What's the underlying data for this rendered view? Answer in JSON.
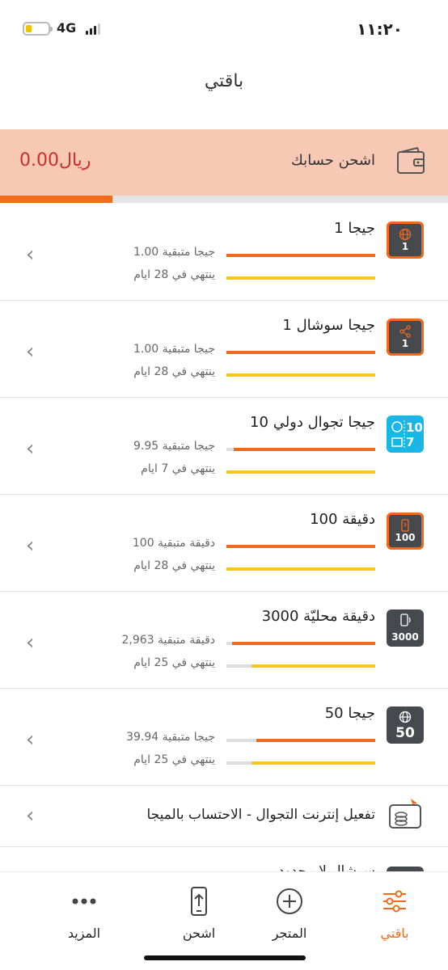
{
  "status": {
    "time": "١١:٢٠",
    "network": "4G",
    "battery_level": 0.25
  },
  "header": {
    "title": "باقتي"
  },
  "recharge": {
    "label": "اشحن حسابك",
    "balance": "0.00ريال",
    "progress": 0.25
  },
  "plans": [
    {
      "name": "1 جيجا",
      "remaining": "1.00 جيجا متبقية",
      "expiry": "ينتهي في 28 ايام",
      "icon": "globe-icon",
      "badge": "1",
      "remaining_frac": 1.0,
      "expiry_frac": 1.0,
      "style": "orange"
    },
    {
      "name": "1 جيجا سوشال",
      "remaining": "1.00 جيجا متبقية",
      "expiry": "ينتهي في 28 ايام",
      "icon": "share-icon",
      "badge": "1",
      "remaining_frac": 1.0,
      "expiry_frac": 1.0,
      "style": "orange"
    },
    {
      "name": "10 جيجا تجوال دولي",
      "remaining": "9.95 جيجا متبقية",
      "expiry": "ينتهي في 7 ايام",
      "icon": "roaming-ticket-icon",
      "badge": "10 7",
      "remaining_frac": 0.95,
      "expiry_frac": 1.0,
      "style": "cyan"
    },
    {
      "name": "100 دقيقة",
      "remaining": "100 دقيقة متبقية",
      "expiry": "ينتهي في 28 ايام",
      "icon": "phone-icon",
      "badge": "100",
      "remaining_frac": 1.0,
      "expiry_frac": 1.0,
      "style": "orange"
    },
    {
      "name": "3000 دقيقة محليّة",
      "remaining": "2,963 دقيقة متبقية",
      "expiry": "ينتهي في 25 ايام",
      "icon": "phone-call-icon",
      "badge": "3000",
      "remaining_frac": 0.96,
      "expiry_frac": 0.83,
      "style": "grey"
    },
    {
      "name": "50 جيجا",
      "remaining": "39.94 جيجا متبقية",
      "expiry": "ينتهي في 25 ايام",
      "icon": "globe-icon",
      "badge": "50",
      "remaining_frac": 0.8,
      "expiry_frac": 0.83,
      "style": "grey"
    }
  ],
  "roaming_activation": {
    "label": "تفعيل إنترنت التجوال - الاحتساب بالميجا"
  },
  "partial_item": {
    "label": "سوشال لا محدود"
  },
  "tabs": [
    {
      "label": "باقتي",
      "icon": "sliders-icon",
      "active": true
    },
    {
      "label": "المتجر",
      "icon": "plus-circle-icon",
      "active": false
    },
    {
      "label": "اشحن",
      "icon": "mobile-upload-icon",
      "active": false
    },
    {
      "label": "المزيد",
      "icon": "more-dots-icon",
      "active": false
    }
  ],
  "colors": {
    "accent": "#f26a1b",
    "expiry_bar": "#f5c518",
    "banner_bg": "#f7c8b3",
    "balance": "#c9302c"
  }
}
